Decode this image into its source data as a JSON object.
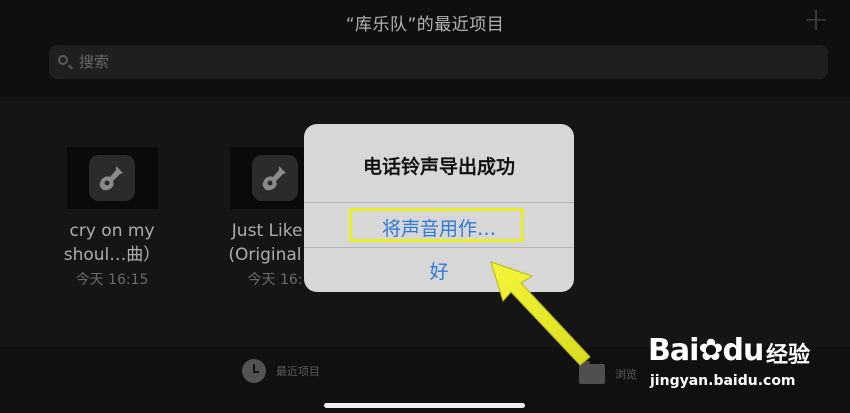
{
  "header": {
    "title": "“库乐队”的最近项目",
    "add_icon": "+"
  },
  "search": {
    "placeholder": "搜索"
  },
  "projects": [
    {
      "name_line1": "cry on my",
      "name_line2": "shoul…曲）",
      "time": "今天 16:15"
    },
    {
      "name_line1": "Just Like T",
      "name_line2": "(Original M",
      "time": "今天 16:"
    }
  ],
  "alert": {
    "title": "电话铃声导出成功",
    "use_sound_label": "将声音用作…",
    "ok_label": "好"
  },
  "tabbar": {
    "recent_label": "最近项目",
    "browse_label": "浏览"
  },
  "watermark": {
    "brand": "Bai",
    "brand_suffix": "du",
    "jingyan": "经验",
    "url": "jingyan.baidu.com"
  },
  "colors": {
    "alert_button": "#2f7ad8",
    "highlight": "#e9ec2a",
    "arrow": "#e9ec2a"
  }
}
